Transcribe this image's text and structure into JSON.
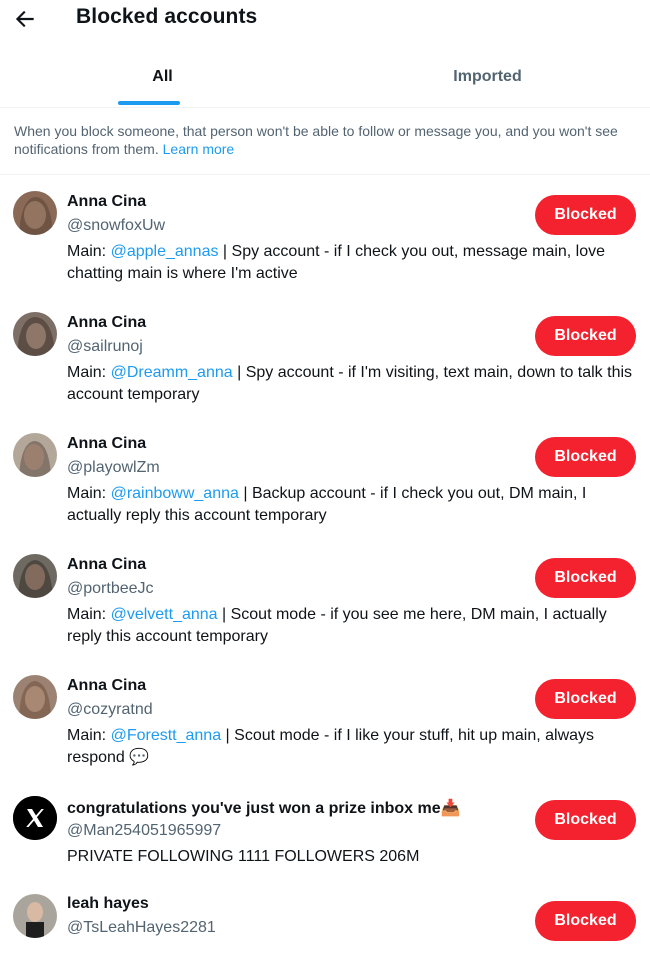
{
  "header": {
    "title": "Blocked accounts",
    "back_icon": "arrow-left-icon"
  },
  "tabs": [
    {
      "label": "All",
      "active": true
    },
    {
      "label": "Imported",
      "active": false
    }
  ],
  "notice": {
    "text": "When you block someone, that person won't be able to follow or message you, and you won't see notifications from them.",
    "link": "Learn more"
  },
  "button_label": "Blocked",
  "accounts": [
    {
      "name": "Anna Cina",
      "handle": "@snowfoxUw",
      "bio_prefix": "Main: ",
      "mention": "@apple_annas",
      "bio_suffix": " | Spy account - if I check you out, message main, love chatting main is where I'm active"
    },
    {
      "name": "Anna Cina",
      "handle": "@sailrunoj",
      "bio_prefix": "Main: ",
      "mention": "@Dreamm_anna",
      "bio_suffix": " | Spy account - if I'm visiting, text main, down to talk this account temporary"
    },
    {
      "name": "Anna Cina",
      "handle": "@playowlZm",
      "bio_prefix": "Main: ",
      "mention": "@rainboww_anna",
      "bio_suffix": " | Backup account - if I check you out, DM main, I actually reply this account temporary"
    },
    {
      "name": "Anna Cina",
      "handle": "@portbeeJc",
      "bio_prefix": "Main: ",
      "mention": "@velvett_anna",
      "bio_suffix": " | Scout mode - if you see me here, DM main, I actually reply this account temporary"
    },
    {
      "name": "Anna Cina",
      "handle": "@cozyratnd",
      "bio_prefix": "Main: ",
      "mention": "@Forestt_anna",
      "bio_suffix": " | Scout mode - if I like your stuff, hit up main, always respond 💬"
    },
    {
      "name": "congratulations you've just won a prize inbox me📥",
      "handle": "@Man254051965997",
      "bio_prefix": "PRIVATE FOLLOWING 1111 FOLLOWERS 206M",
      "mention": "",
      "bio_suffix": ""
    },
    {
      "name": "leah hayes",
      "handle": "@TsLeahHayes2281",
      "bio_prefix": "",
      "mention": "",
      "bio_suffix": ""
    }
  ],
  "colors": {
    "accent": "#1d9bf0",
    "blocked_button": "#f4212e",
    "secondary_text": "#536471"
  }
}
